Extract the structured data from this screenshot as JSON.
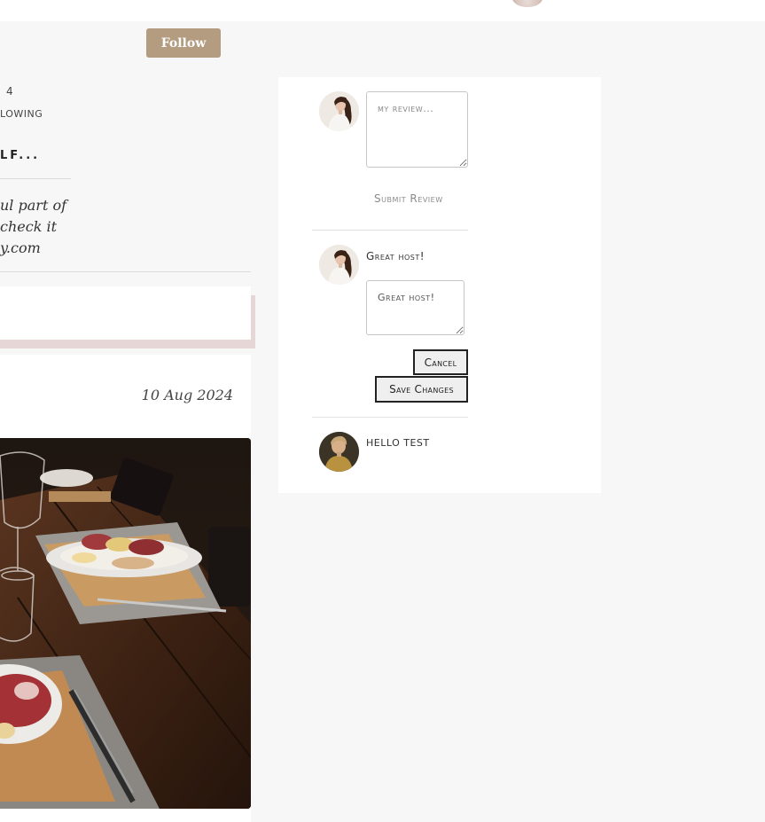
{
  "header": {
    "follow_label": "Follow"
  },
  "profile": {
    "following_count": "4",
    "following_label": "LOWING",
    "about_title": "LF...",
    "bio_lines": [
      "ul part of",
      "check it",
      "y.com"
    ]
  },
  "post": {
    "date": "10 Aug 2024"
  },
  "reviews": {
    "new_review": {
      "placeholder": "my review...",
      "submit_label": "Submit Review"
    },
    "items": [
      {
        "text": "Great host!",
        "edit_value": "Great host!",
        "cancel_label": "Cancel",
        "save_label": "Save Changes"
      },
      {
        "text": "HELLO TEST"
      }
    ]
  }
}
